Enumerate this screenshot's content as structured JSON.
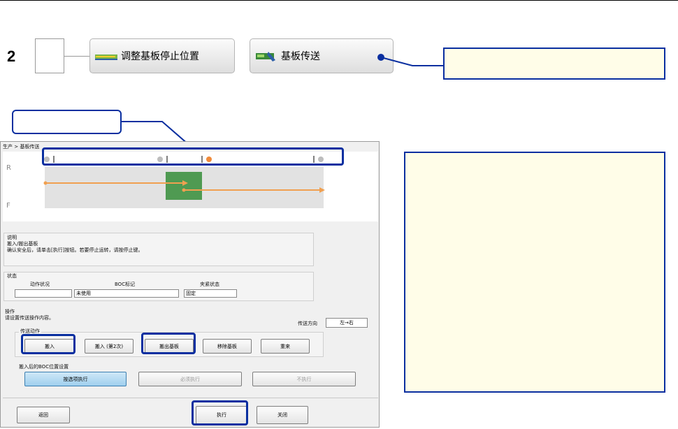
{
  "step": {
    "number": "2"
  },
  "buttons": {
    "adjust": {
      "label": "调整基板停止位置"
    },
    "transfer": {
      "label": "基板传送"
    }
  },
  "window": {
    "breadcrumb": "生产 > 基板传送",
    "lanes": {
      "rear": "R",
      "front": "F"
    },
    "description": {
      "title": "说明",
      "line1": "搬入/搬出基板",
      "line2": "确认安全后，请单击[执行]按钮。若要停止运转，请按停止键。"
    },
    "status": {
      "title": "状态",
      "headers": [
        "动作状况",
        "BOC标记",
        "夹紧状态"
      ],
      "values": [
        "",
        "未使用",
        "固定"
      ]
    },
    "operation": {
      "title": "操作",
      "instruction": "请设置传送操作内容。",
      "direction_label": "传送方向",
      "direction_value": "左→右",
      "action_group_label": "传送动作",
      "actions": [
        "搬入",
        "搬入 (第2次)",
        "搬出基板",
        "移除基板",
        "重来"
      ],
      "boc_label": "搬入后的BOC位置设置",
      "boc_options": [
        "按选项执行",
        "必须执行",
        "不执行"
      ]
    },
    "footer": {
      "back": "返回",
      "execute": "执行",
      "close": "关闭"
    }
  },
  "colors": {
    "highlight": "#0a2fa0",
    "board": "#4f9a52",
    "arrow": "#f0a050",
    "callout_bg": "#fffde8"
  }
}
